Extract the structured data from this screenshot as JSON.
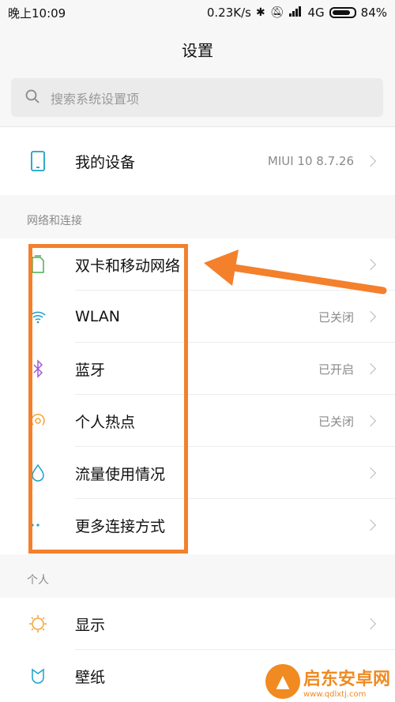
{
  "status_bar": {
    "time": "晚上10:09",
    "speed": "0.23K/s",
    "network": "4G",
    "battery": "84%"
  },
  "header": {
    "title": "设置"
  },
  "search": {
    "placeholder": "搜索系统设置项"
  },
  "device": {
    "label": "我的设备",
    "value": "MIUI 10 8.7.26"
  },
  "sections": {
    "network": {
      "title": "网络和连接",
      "items": [
        {
          "label": "双卡和移动网络",
          "value": "",
          "icon": "sim-card-icon"
        },
        {
          "label": "WLAN",
          "value": "已关闭",
          "icon": "wifi-icon"
        },
        {
          "label": "蓝牙",
          "value": "已开启",
          "icon": "bluetooth-icon"
        },
        {
          "label": "个人热点",
          "value": "已关闭",
          "icon": "hotspot-icon"
        },
        {
          "label": "流量使用情况",
          "value": "",
          "icon": "data-usage-icon"
        },
        {
          "label": "更多连接方式",
          "value": "",
          "icon": "more-icon"
        }
      ]
    },
    "personal": {
      "title": "个人",
      "items": [
        {
          "label": "显示",
          "value": "",
          "icon": "display-icon"
        },
        {
          "label": "壁纸",
          "value": "",
          "icon": "wallpaper-icon"
        }
      ]
    }
  },
  "colors": {
    "annotation": "#f4802c",
    "accent": "#1ba0c8"
  },
  "watermark": {
    "title": "启东安卓网",
    "url": "www.qdlxtj.com"
  }
}
